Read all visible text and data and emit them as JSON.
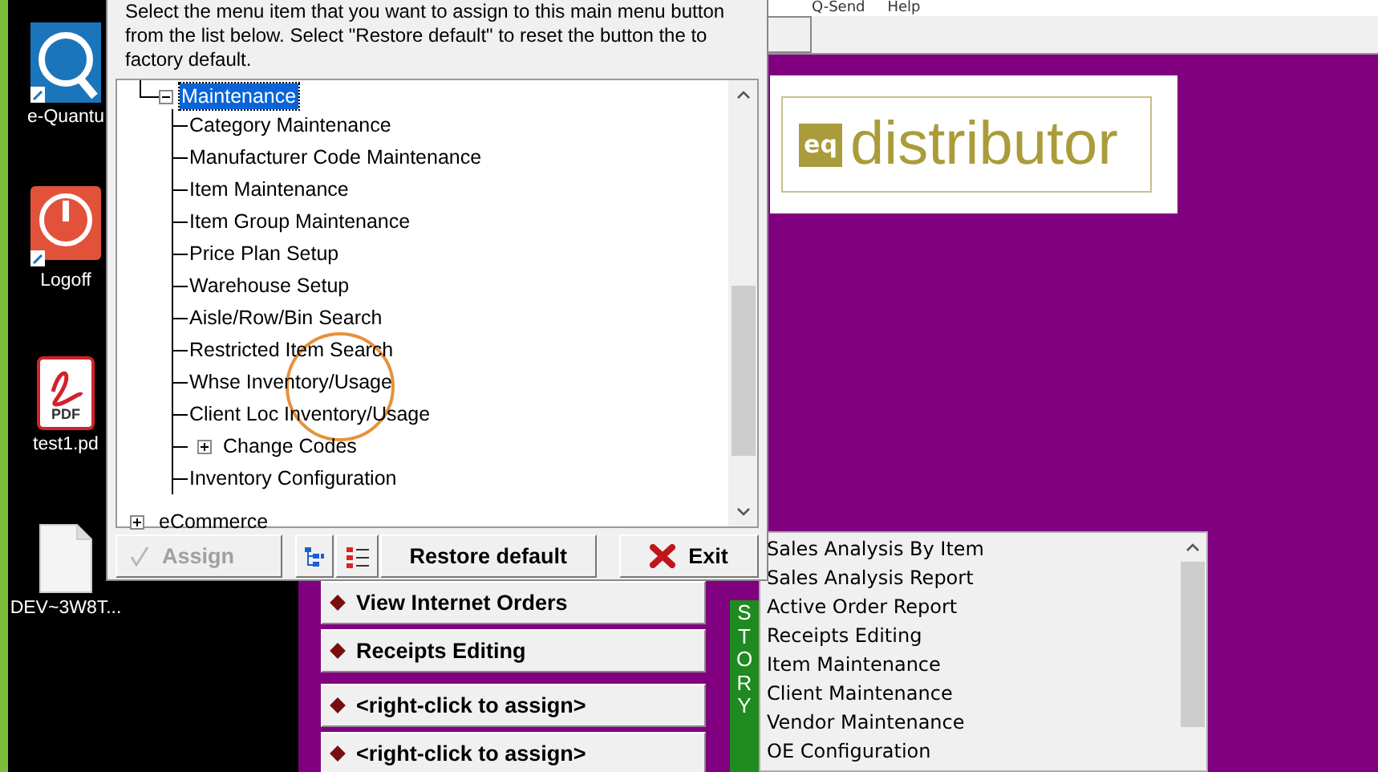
{
  "desktop_icons": [
    {
      "label": "e-Quantu",
      "kind": "app"
    },
    {
      "label": "Logoff",
      "kind": "logoff"
    },
    {
      "label": "test1.pd",
      "kind": "pdf",
      "badge": "PDF"
    },
    {
      "label": "DEV~3W8T...",
      "kind": "file"
    }
  ],
  "menu_bar": [
    "Q-Send",
    "Help"
  ],
  "dialog": {
    "instructions": "Select the menu item that you want to assign to this main menu button from the list below.  Select \"Restore default\" to reset the button the to factory default.",
    "tree": [
      {
        "label": "Maintenance",
        "selected": true,
        "expanded": true,
        "children": [
          {
            "label": "Category Maintenance",
            "selected": false
          },
          {
            "label": "Manufacturer Code Maintenance",
            "selected": false
          },
          {
            "label": "Item Maintenance",
            "selected": false
          },
          {
            "label": "Item Group Maintenance",
            "selected": false
          },
          {
            "label": "Price Plan Setup",
            "selected": false
          },
          {
            "label": "Warehouse Setup",
            "selected": false
          },
          {
            "label": "Aisle/Row/Bin Search",
            "selected": false
          },
          {
            "label": "Restricted Item Search",
            "selected": false
          },
          {
            "label": "Whse Inventory/Usage",
            "selected": false
          },
          {
            "label": "Client Loc Inventory/Usage",
            "selected": false
          },
          {
            "label": "Change Codes",
            "selected": false,
            "expanded": false
          },
          {
            "label": "Inventory Configuration",
            "selected": false
          }
        ]
      },
      {
        "label": "eCommerce",
        "selected": false,
        "expanded": false
      }
    ],
    "buttons": [
      {
        "kind": "assign",
        "label": "Assign",
        "disabled": true
      },
      {
        "kind": "tree-view",
        "disabled": false
      },
      {
        "kind": "list-view",
        "disabled": false
      },
      {
        "kind": "restore",
        "label": "Restore default",
        "disabled": false
      },
      {
        "kind": "exit",
        "label": "Exit",
        "disabled": false
      }
    ]
  },
  "logo": {
    "badge": "eq",
    "text": "distributor"
  },
  "menu_buttons": [
    "View Internet Orders",
    "Receipts Editing",
    "<right-click to assign>",
    "<right-click to assign>"
  ],
  "history": {
    "tab_label": "STORY",
    "items": [
      "Sales Analysis By Item",
      "Sales Analysis Report",
      "Active Order Report",
      "Receipts Editing",
      "Item Maintenance",
      "Client Maintenance",
      "Vendor Maintenance",
      "OE Configuration"
    ]
  }
}
